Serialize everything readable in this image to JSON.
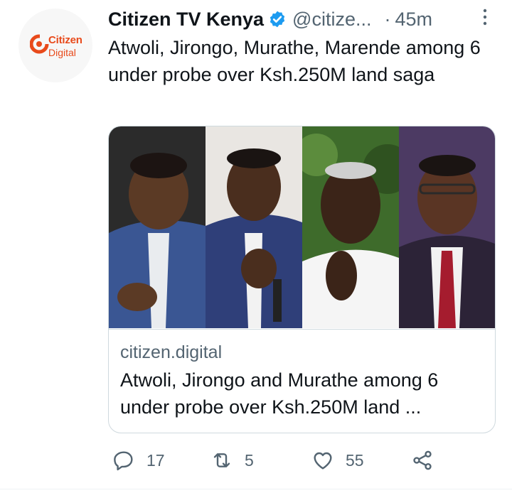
{
  "author": {
    "display_name": "Citizen TV Kenya",
    "handle": "@citize...",
    "separator": "·",
    "time": "45m",
    "avatar": {
      "logo_line1": "Citizen",
      "logo_line2": "Digital"
    }
  },
  "tweet": {
    "text": "Atwoli, Jirongo, Murathe, Marende among 6 under probe over Ksh.250M land saga"
  },
  "card": {
    "domain": "citizen.digital",
    "title": "Atwoli, Jirongo and Murathe among 6 under probe over Ksh.250M land ..."
  },
  "actions": {
    "reply_count": "17",
    "retweet_count": "5",
    "like_count": "55"
  },
  "colors": {
    "brand_orange": "#e84a1b",
    "verified_blue": "#1d9bf0",
    "text_primary": "#0f1419",
    "text_secondary": "#536471",
    "border": "#cfd9de"
  },
  "icons": [
    "verified-badge-icon",
    "more-options-icon",
    "reply-icon",
    "retweet-icon",
    "like-icon",
    "share-icon"
  ]
}
